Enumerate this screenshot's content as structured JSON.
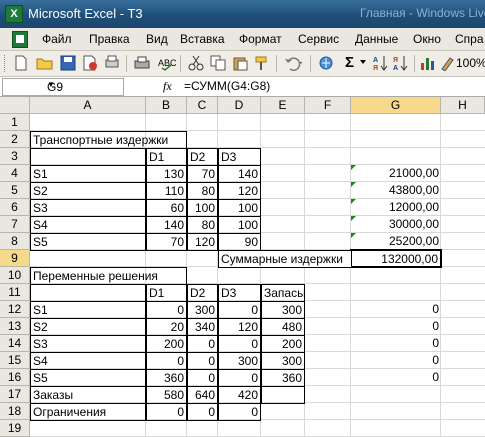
{
  "window": {
    "title": "Microsoft Excel - T3",
    "ghost_title": "Главная - Windows Live"
  },
  "menu": [
    "Файл",
    "Правка",
    "Вид",
    "Вставка",
    "Формат",
    "Сервис",
    "Данные",
    "Окно",
    "Спра"
  ],
  "toolbar": {
    "zoom": "100%",
    "sigma": "Σ"
  },
  "formula_bar": {
    "name_box": "G9",
    "fx": "fx",
    "formula": "=СУММ(G4:G8)"
  },
  "columns": [
    "A",
    "B",
    "C",
    "D",
    "E",
    "F",
    "G",
    "H"
  ],
  "rows": [
    "1",
    "2",
    "3",
    "4",
    "5",
    "6",
    "7",
    "8",
    "9",
    "10",
    "11",
    "12",
    "13",
    "14",
    "15",
    "16",
    "17",
    "18",
    "19"
  ],
  "cells": {
    "A2": "Транспортные издержки",
    "B3": "D1",
    "C3": "D2",
    "D3": "D3",
    "A4": "S1",
    "B4": "130",
    "C4": "70",
    "D4": "140",
    "G4": "21000,00",
    "A5": "S2",
    "B5": "110",
    "C5": "80",
    "D5": "120",
    "G5": "43800,00",
    "A6": "S3",
    "B6": "60",
    "C6": "100",
    "D6": "100",
    "G6": "12000,00",
    "A7": "S4",
    "B7": "140",
    "C7": "80",
    "D7": "100",
    "G7": "30000,00",
    "A8": "S5",
    "B8": "70",
    "C8": "120",
    "D8": "90",
    "G8": "25200,00",
    "D9": "Суммарные издержки",
    "G9": "132000,00",
    "A10": "Переменные решения",
    "B11": "D1",
    "C11": "D2",
    "D11": "D3",
    "E11": "Запасы",
    "A12": "S1",
    "B12": "0",
    "C12": "300",
    "D12": "0",
    "E12": "300",
    "G12": "0",
    "A13": "S2",
    "B13": "20",
    "C13": "340",
    "D13": "120",
    "E13": "480",
    "G13": "0",
    "A14": "S3",
    "B14": "200",
    "C14": "0",
    "D14": "0",
    "E14": "200",
    "G14": "0",
    "A15": "S4",
    "B15": "0",
    "C15": "0",
    "D15": "300",
    "E15": "300",
    "G15": "0",
    "A16": "S5",
    "B16": "360",
    "C16": "0",
    "D16": "0",
    "E16": "360",
    "G16": "0",
    "A17": "Заказы",
    "B17": "580",
    "C17": "640",
    "D17": "420",
    "A18": "Ограничения",
    "B18": "0",
    "C18": "0",
    "D18": "0"
  }
}
